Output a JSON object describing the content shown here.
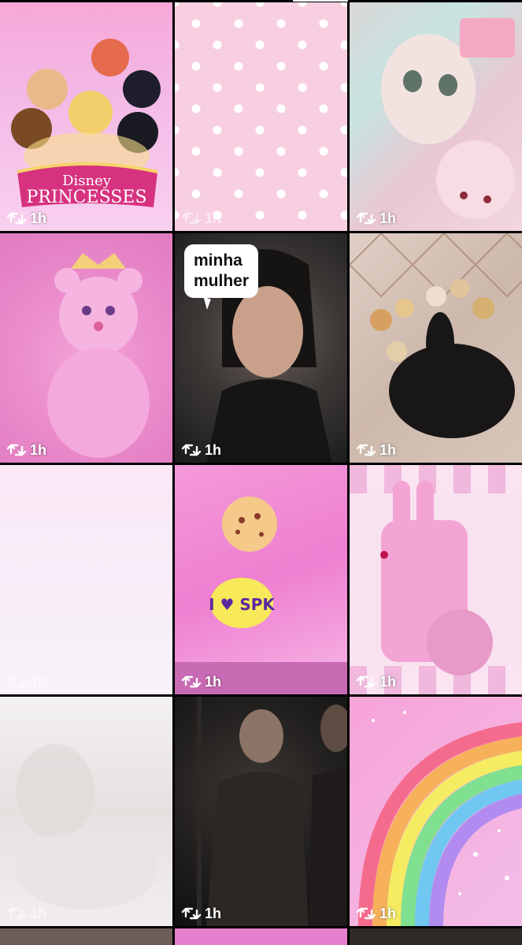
{
  "grid": {
    "tiles": [
      {
        "label": "1h",
        "theme": "disney-princesses",
        "caption": ""
      },
      {
        "label": "1h",
        "theme": "pink-polka-dots",
        "caption": ""
      },
      {
        "label": "1h",
        "theme": "pastel-doll",
        "caption": ""
      },
      {
        "label": "1h",
        "theme": "pink-teddy-bear",
        "caption": ""
      },
      {
        "label": "1h",
        "theme": "ellie-portrait",
        "caption": "minha mulher"
      },
      {
        "label": "1h",
        "theme": "rabbit-and-figurines",
        "caption": ""
      },
      {
        "label": "1h",
        "theme": "blank-pink",
        "caption": ""
      },
      {
        "label": "1h",
        "theme": "shopkins-shirt",
        "caption": ""
      },
      {
        "label": "1h",
        "theme": "bunny-phone-case",
        "caption": ""
      },
      {
        "label": "1h",
        "theme": "misty-photo",
        "caption": ""
      },
      {
        "label": "1h",
        "theme": "ellie-dark-scene",
        "caption": ""
      },
      {
        "label": "1h",
        "theme": "rainbow-sprinkles",
        "caption": ""
      }
    ],
    "repost_icon": "repost-icon"
  },
  "tile_art": {
    "princess_logo_line1": "Disney",
    "princess_logo_line2": "PRINCESSES",
    "shirt_text": "I ♥ SPK",
    "speech_line1": "minha",
    "speech_line2": "mulher"
  },
  "colors": {
    "overlay_text": "#ffffff",
    "grid_gap": "#000000",
    "pink_accent": "#f0a6da"
  }
}
